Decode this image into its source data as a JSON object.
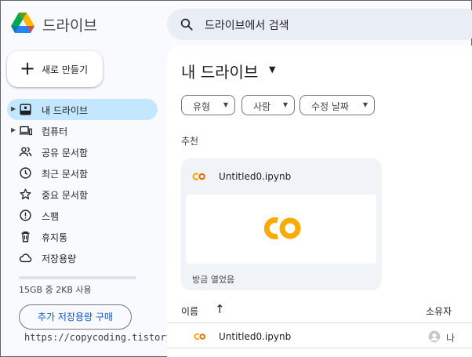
{
  "header": {
    "app_name": "드라이브",
    "search_placeholder": "드라이브에서 검색"
  },
  "new_button": {
    "label": "새로 만들기"
  },
  "sidebar": {
    "items": [
      {
        "label": "내 드라이브",
        "icon": "drive-icon",
        "active": true,
        "expandable": true
      },
      {
        "label": "컴퓨터",
        "icon": "computer-icon",
        "active": false,
        "expandable": true
      },
      {
        "label": "공유 문서함",
        "icon": "people-icon",
        "active": false,
        "expandable": false
      },
      {
        "label": "최근 문서함",
        "icon": "clock-icon",
        "active": false,
        "expandable": false
      },
      {
        "label": "중요 문서함",
        "icon": "star-icon",
        "active": false,
        "expandable": false
      },
      {
        "label": "스팸",
        "icon": "spam-icon",
        "active": false,
        "expandable": false
      },
      {
        "label": "휴지통",
        "icon": "trash-icon",
        "active": false,
        "expandable": false
      },
      {
        "label": "저장용량",
        "icon": "cloud-icon",
        "active": false,
        "expandable": false
      }
    ],
    "storage": {
      "used_text": "15GB 중 2KB 사용",
      "used_fraction": 0.0
    },
    "buy_storage_label": "추가 저장용량 구매"
  },
  "watermark": "https://copycoding.tistory.com/",
  "main": {
    "title": "내 드라이브",
    "filters": [
      {
        "label": "유형"
      },
      {
        "label": "사람"
      },
      {
        "label": "수정 날짜"
      }
    ],
    "suggested_title": "추천",
    "suggested_card": {
      "file_name": "Untitled0.ipynb",
      "opened_text": "방금 열었음"
    },
    "list": {
      "name_header": "이름",
      "owner_header": "소유자",
      "rows": [
        {
          "name": "Untitled0.ipynb",
          "owner": "나"
        }
      ]
    }
  },
  "colors": {
    "accent": "#0b57d0",
    "active_bg": "#c2e7ff",
    "colab_orange": "#f9ab00",
    "colab_yellow": "#e8710a"
  }
}
